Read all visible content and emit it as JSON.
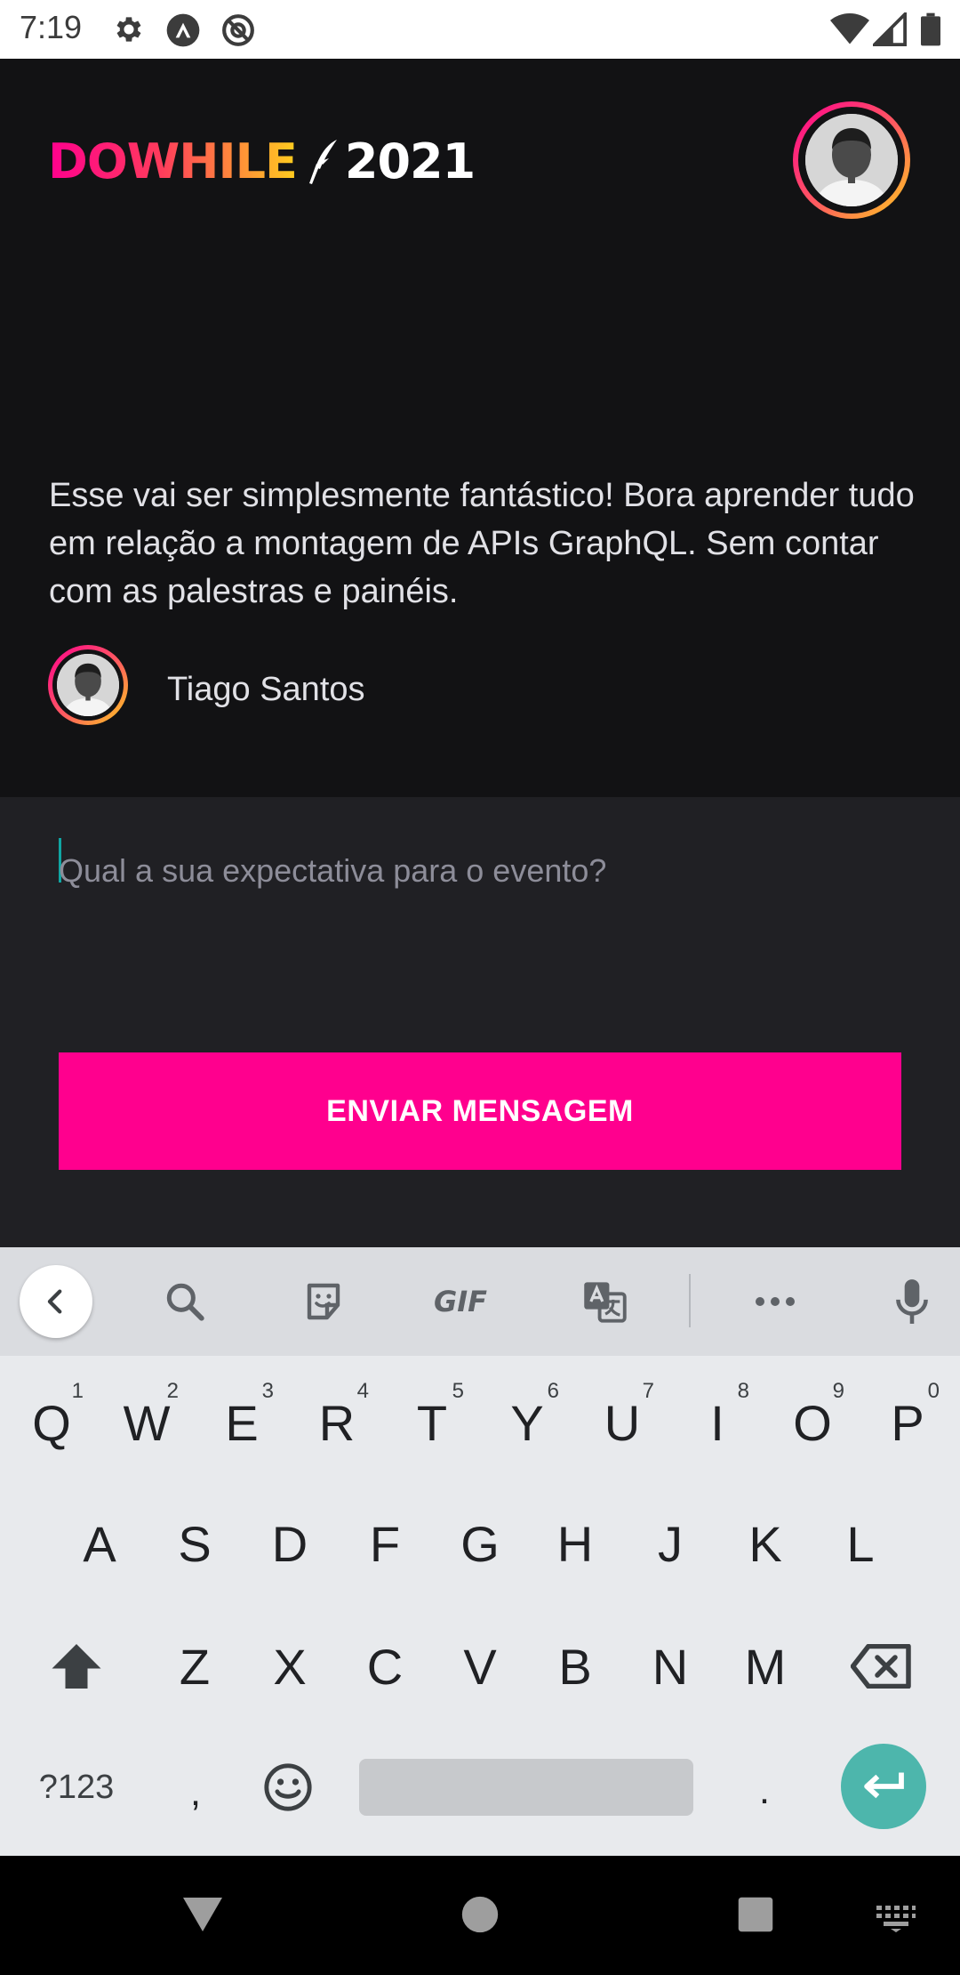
{
  "status_bar": {
    "time": "7:19",
    "icons": [
      "gear-icon",
      "app-a-icon",
      "no-tracking-icon",
      "wifi-icon",
      "signal-icon",
      "battery-icon"
    ]
  },
  "header": {
    "logo_primary": "DOWHILE",
    "logo_year": "2021"
  },
  "message": {
    "text": "Esse vai ser simplesmente fantástico! Bora aprender tudo em relação a montagem de APIs GraphQL. Sem contar com as palestras e painéis.",
    "author": "Tiago Santos"
  },
  "form": {
    "placeholder": "Qual a sua expectativa para o evento?",
    "value": "",
    "send_label": "ENVIAR MENSAGEM"
  },
  "keyboard": {
    "toolbar": [
      "back-icon",
      "search-icon",
      "sticker-icon",
      "gif-icon",
      "translate-icon",
      "more-icon",
      "mic-icon"
    ],
    "gif_label": "GIF",
    "row1": [
      {
        "k": "Q",
        "h": "1"
      },
      {
        "k": "W",
        "h": "2"
      },
      {
        "k": "E",
        "h": "3"
      },
      {
        "k": "R",
        "h": "4"
      },
      {
        "k": "T",
        "h": "5"
      },
      {
        "k": "Y",
        "h": "6"
      },
      {
        "k": "U",
        "h": "7"
      },
      {
        "k": "I",
        "h": "8"
      },
      {
        "k": "O",
        "h": "9"
      },
      {
        "k": "P",
        "h": "0"
      }
    ],
    "row2": [
      "A",
      "S",
      "D",
      "F",
      "G",
      "H",
      "J",
      "K",
      "L"
    ],
    "row3": [
      "Z",
      "X",
      "C",
      "V",
      "B",
      "N",
      "M"
    ],
    "symbols_label": "?123",
    "comma": ",",
    "period": "."
  },
  "colors": {
    "background": "#121214",
    "form_background": "#202024",
    "accent": "#ff008e",
    "gradient_mid": "#ff5e5e",
    "gradient_end": "#ffcd1e",
    "text": "#e1e1e6",
    "placeholder": "#8d8d99",
    "keyboard": "#e8eaed",
    "enter_key": "#4db6ac"
  }
}
